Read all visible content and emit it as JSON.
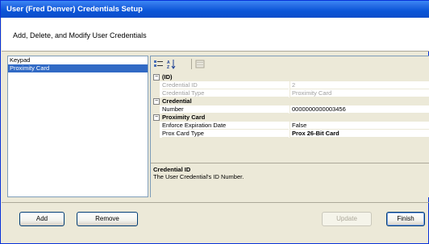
{
  "window": {
    "title": "User (Fred Denver) Credentials Setup",
    "header": "Add, Delete, and Modify User Credentials"
  },
  "credentials": {
    "items": [
      {
        "label": "Keypad",
        "selected": false
      },
      {
        "label": "Proximity Card",
        "selected": true
      }
    ]
  },
  "property_grid": {
    "toolbar": {
      "icons": [
        "categorized-icon",
        "alphabetical-icon",
        "property-pages-icon"
      ]
    },
    "categories": [
      {
        "name": "(ID)",
        "expanded": true,
        "properties": [
          {
            "name": "Credential ID",
            "value": "2",
            "readonly": true
          },
          {
            "name": "Credential Type",
            "value": "Proximity Card",
            "readonly": true
          }
        ]
      },
      {
        "name": "Credential",
        "expanded": true,
        "properties": [
          {
            "name": "Number",
            "value": "0000000000003456",
            "readonly": false
          }
        ]
      },
      {
        "name": "Proximity Card",
        "expanded": true,
        "properties": [
          {
            "name": "Enforce Expiration Date",
            "value": "False",
            "readonly": false
          },
          {
            "name": "Prox Card Type",
            "value": "Prox 26-Bit Card",
            "readonly": false,
            "bold": true
          }
        ]
      }
    ],
    "description": {
      "title": "Credential ID",
      "text": "The User Credential's ID Number."
    }
  },
  "buttons": {
    "add": "Add",
    "remove": "Remove",
    "update": "Update",
    "finish": "Finish"
  },
  "colors": {
    "titlebar": "#0a55d8",
    "selection": "#316ac5",
    "dialog": "#ece9d8"
  }
}
